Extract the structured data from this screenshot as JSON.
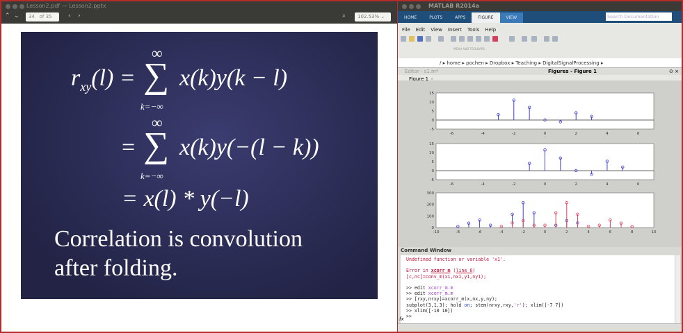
{
  "pdf": {
    "title": "Lesson2.pdf — Lesson2.pptx",
    "page": "34",
    "of": "of 35",
    "zoom": "102.53%",
    "slide": {
      "line1": "r",
      "sub": "xy",
      "l1rest": "(l) =",
      "sum_top": "∞",
      "sum_bot": "k=−∞",
      "term1": "x(k)y(k − l)",
      "eq2": "=",
      "term2": "x(k)y(−(l − k))",
      "eq3": "= x(l) * y(−l)",
      "text1": "Correlation is convolution",
      "text2": "after folding."
    }
  },
  "matlab": {
    "title": "MATLAB R2014a",
    "tabs": [
      "HOME",
      "PLOTS",
      "APPS",
      "FIGURE",
      "VIEW"
    ],
    "search_placeholder": "Search Documentation",
    "menu": [
      "File",
      "Edit",
      "View",
      "Insert",
      "Tools",
      "Help"
    ],
    "toolbar_label": "MENU AND TOOLBARS",
    "path": "/ ▸ home ▸ pochen ▸ Dropbox ▸ Teaching ▸ DigitalSignalProcessing ▸",
    "editor_tab": "Editor - s1.m*",
    "figures_title": "Figures - Figure 1",
    "figure_tab": "Figure 1",
    "cw_title": "Command Window",
    "cw": {
      "l1": "Undefined function or variable 'x1'.",
      "l2a": "Error in ",
      "l2b": "xcorr_m",
      "l2c": " (",
      "l2d": "line 6",
      "l2e": ")",
      "l3": "[c,nc]=conv_m(x1,nx1,y1,ny1);",
      "l4a": ">> edit ",
      "l4b": "xcorr_m.m",
      "l5a": ">> edit ",
      "l5b": "xcorr_m.m",
      "l6": ">> [rxy,nrxy]=xcorr_m(x,nx,y,ny);",
      "l7a": "subplot(3,1,3); hold ",
      "l7b": "on",
      "l7c": "; stem(nrxy,rxy,",
      "l7d": "'r'",
      "l7e": "); xlim([-7 7])",
      "l8": ">> xlim([-10 10])",
      "l9": ">>",
      "fx": "fx"
    }
  },
  "chart_data": [
    {
      "type": "stem",
      "xlim": [
        -7,
        7
      ],
      "ylim": [
        -5,
        15
      ],
      "xticks": [
        -6,
        -4,
        -2,
        0,
        2,
        4,
        6
      ],
      "yticks": [
        -5,
        0,
        5,
        10,
        15
      ],
      "series": [
        {
          "color": "#4040d0",
          "x": [
            -3,
            -2,
            -1,
            0,
            1,
            2,
            3
          ],
          "y": [
            3,
            11,
            7,
            0,
            -1,
            4,
            2
          ]
        }
      ]
    },
    {
      "type": "stem",
      "xlim": [
        -7,
        7
      ],
      "ylim": [
        -5,
        15
      ],
      "xticks": [
        -6,
        -4,
        -2,
        0,
        2,
        4,
        6
      ],
      "yticks": [
        -5,
        0,
        5,
        10,
        15
      ],
      "series": [
        {
          "color": "#4040d0",
          "x": [
            -1,
            0,
            1,
            2,
            3,
            4,
            5
          ],
          "y": [
            4,
            11.5,
            7,
            0,
            -2,
            5.2,
            2
          ]
        }
      ]
    },
    {
      "type": "stem",
      "xlim": [
        -10,
        10
      ],
      "ylim": [
        0,
        300
      ],
      "xticks": [
        -10,
        -8,
        -6,
        -4,
        -2,
        0,
        2,
        4,
        6,
        8,
        10
      ],
      "yticks": [
        0,
        100,
        200,
        300
      ],
      "series": [
        {
          "color": "#4040d0",
          "x": [
            -8,
            -7,
            -6,
            -5,
            -3,
            -2,
            -1,
            1,
            2,
            3
          ],
          "y": [
            9,
            38,
            65,
            20,
            115,
            215,
            128,
            20,
            60,
            40
          ]
        },
        {
          "color": "#e0405a",
          "x": [
            -4,
            -3,
            -2,
            -1,
            0,
            1,
            2,
            3,
            4,
            5,
            6,
            7,
            8
          ],
          "y": [
            10,
            40,
            60,
            20,
            20,
            128,
            215,
            115,
            10,
            20,
            65,
            38,
            9
          ]
        }
      ]
    }
  ]
}
